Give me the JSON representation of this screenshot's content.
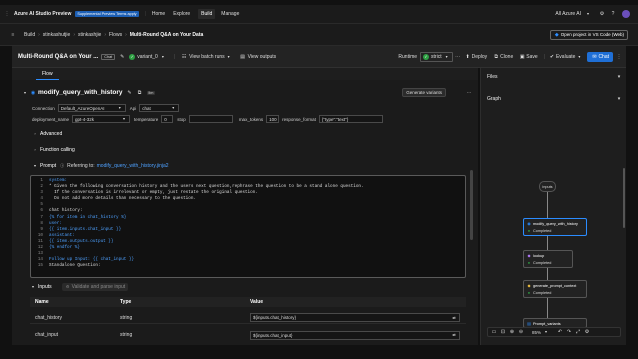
{
  "topbar": {
    "app_title": "Azure AI Studio Preview",
    "badge": "Supplemental Preview Terms apply",
    "nav": [
      "Home",
      "Explore",
      "Build",
      "Manage"
    ],
    "active_nav": "Build",
    "account": "All Azure AI"
  },
  "breadcrumb": [
    "Build",
    "stinkashutjie",
    "stinkashjie",
    "Flows",
    "Multi-Round Q&A on Your Data"
  ],
  "toolbar": {
    "flow_title": "Multi-Round Q&A on Your ...",
    "chat_badge": "Chat",
    "variant": "variant_0",
    "view_batch": "View batch runs",
    "view_outputs": "View outputs",
    "runtime_label": "Runtime",
    "runtime_value": "strict",
    "deploy": "Deploy",
    "clone": "Clone",
    "save": "Save",
    "evaluate": "Evaluate",
    "chat": "Chat",
    "open_vscode": "Open project in VS Code (Web)"
  },
  "tabs": {
    "flow": "Flow"
  },
  "node": {
    "name": "modify_query_with_history",
    "badge": "llm",
    "generate_variants": "Generate variants",
    "connection_label": "Connection",
    "connection_value": "Default_AzureOpenAI",
    "api_label": "Api",
    "api_value": "chat",
    "deployment_label": "deployment_name",
    "deployment_value": "gpt-4-32k",
    "temperature_label": "temperature",
    "temperature_value": "0",
    "stop_label": "stop",
    "stop_value": "",
    "max_tokens_label": "max_tokens",
    "max_tokens_value": "100",
    "response_format_label": "response_format",
    "response_format_value": "{\"type\":\"text\"}",
    "advanced": "Advanced",
    "function_calling": "Function calling",
    "prompt_label": "Prompt",
    "prompt_ref_label": "Referring to:",
    "prompt_ref_file": "modify_query_with_history.jinja2"
  },
  "code": [
    {
      "n": "1",
      "t": "system:"
    },
    {
      "n": "2",
      "t": "* Given the following conversation history and the users next question,rephrase the question to be a stand alone question."
    },
    {
      "n": "3",
      "t": "  If the conversation is irrelevant or empty, just restate the original question."
    },
    {
      "n": "4",
      "t": "  Do not add more details than necessary to the question."
    },
    {
      "n": "5",
      "t": ""
    },
    {
      "n": "6",
      "t": "chat history:"
    },
    {
      "n": "7",
      "t": "{% for item in chat_history %}"
    },
    {
      "n": "8",
      "t": "user:"
    },
    {
      "n": "9",
      "t": "{{ item.inputs.chat_input }}"
    },
    {
      "n": "10",
      "t": "assistant:"
    },
    {
      "n": "11",
      "t": "{{ item.outputs.output }}"
    },
    {
      "n": "12",
      "t": "{% endfor %}"
    },
    {
      "n": "13",
      "t": ""
    },
    {
      "n": "14",
      "t": "Follow up Input: {{ chat_input }}"
    },
    {
      "n": "15",
      "t": "Standalone Question:"
    }
  ],
  "inputs": {
    "title": "Inputs",
    "validate": "Validate and parse input",
    "headers": [
      "Name",
      "Type",
      "Value"
    ],
    "rows": [
      {
        "name": "chat_history",
        "type": "string",
        "value": "${inputs.chat_history}"
      },
      {
        "name": "chat_input",
        "type": "string",
        "value": "${inputs.chat_input}"
      }
    ]
  },
  "right": {
    "files": "Files",
    "graph": "Graph",
    "zoom": "85%",
    "nodes": {
      "inputs": "inputs",
      "n1": "modify_query_with_history",
      "n1_status": "Completed",
      "n2": "lookup",
      "n2_status": "Completed",
      "n3": "generate_prompt_context",
      "n3_status": "Completed",
      "n4": "Prompt_variants"
    }
  },
  "colors": {
    "accent": "#2b8cff",
    "success": "#2ea043"
  }
}
